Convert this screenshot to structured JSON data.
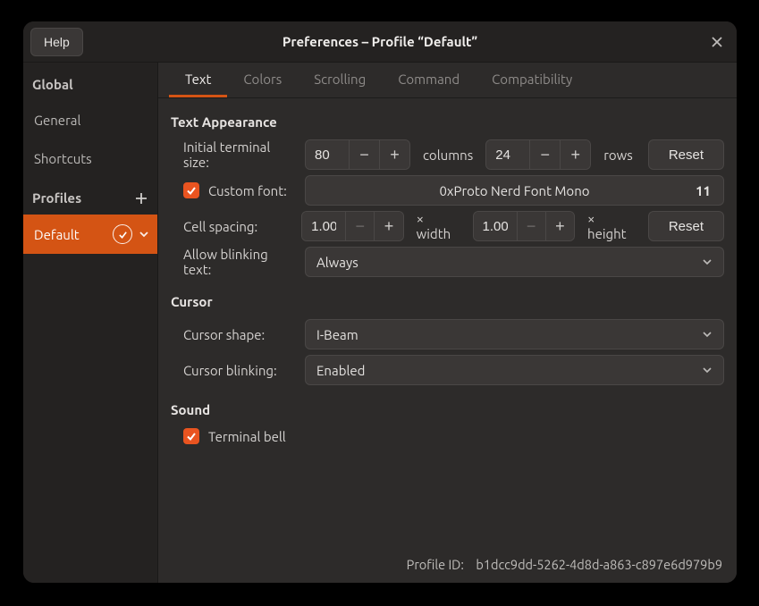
{
  "titlebar": {
    "help": "Help",
    "title": "Preferences – Profile “Default”"
  },
  "sidebar": {
    "global_label": "Global",
    "items": [
      "General",
      "Shortcuts"
    ],
    "profiles_label": "Profiles",
    "profiles": [
      "Default"
    ]
  },
  "tabs": [
    "Text",
    "Colors",
    "Scrolling",
    "Command",
    "Compatibility"
  ],
  "active_tab": 0,
  "text_appearance": {
    "heading": "Text Appearance",
    "initial_size_label": "Initial terminal size:",
    "columns_value": "80",
    "columns_unit": "columns",
    "rows_value": "24",
    "rows_unit": "rows",
    "reset": "Reset",
    "custom_font_label": "Custom font:",
    "custom_font_checked": true,
    "font_name": "0xProto Nerd Font Mono",
    "font_size": "11",
    "cell_spacing_label": "Cell spacing:",
    "cell_width": "1.00",
    "width_unit": "× width",
    "cell_height": "1.00",
    "height_unit": "× height",
    "blink_label": "Allow blinking text:",
    "blink_value": "Always"
  },
  "cursor": {
    "heading": "Cursor",
    "shape_label": "Cursor shape:",
    "shape_value": "I-Beam",
    "blink_label": "Cursor blinking:",
    "blink_value": "Enabled"
  },
  "sound": {
    "heading": "Sound",
    "bell_label": "Terminal bell",
    "bell_checked": true
  },
  "footer": {
    "label": "Profile ID:",
    "value": "b1dcc9dd-5262-4d8d-a863-c897e6d979b9"
  }
}
